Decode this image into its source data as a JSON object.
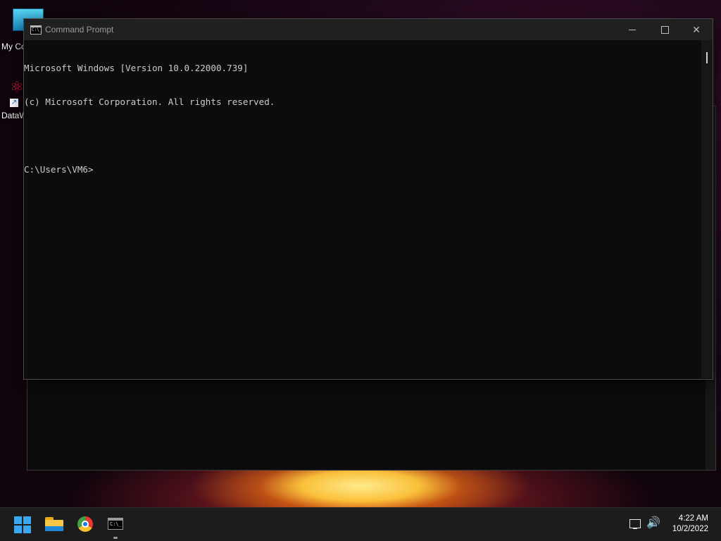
{
  "desktop": {
    "icons": [
      {
        "label": "My Co",
        "name": "this-pc"
      },
      {
        "label": "DataW",
        "name": "datawarrior-shortcut"
      }
    ]
  },
  "cmd_window": {
    "title": "Command Prompt",
    "icon_glyph": "C:\\_",
    "buttons": {
      "minimize": "minimize",
      "maximize": "maximize",
      "close": "✕"
    },
    "lines": [
      "Microsoft Windows [Version 10.0.22000.739]",
      "(c) Microsoft Corporation. All rights reserved.",
      "",
      "C:\\Users\\VM6>"
    ]
  },
  "taskbar": {
    "apps": [
      "start",
      "file-explorer",
      "chrome",
      "command-prompt"
    ],
    "cmd_icon_glyph": "C:\\_",
    "tray": {
      "volume_glyph": "🔊"
    },
    "clock": {
      "time": "4:22 AM",
      "date": "10/2/2022"
    }
  },
  "colors": {
    "console_bg": "#0c0c0c",
    "console_text": "#cccccc",
    "titlebar": "#202020",
    "taskbar": "#1c1c1c",
    "start_blue": "#3aa7f0"
  }
}
